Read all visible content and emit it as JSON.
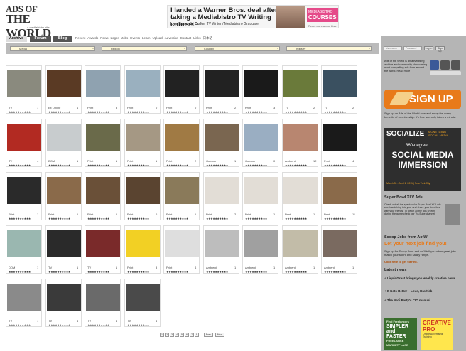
{
  "logo": {
    "line1": "ADS OF",
    "line2": "THE WORLD",
    "sub": "A mediabistro site"
  },
  "ad_banner": {
    "headline": "I landed a Warner Bros. deal after taking a Mediabistro TV Writing course.",
    "name": "Lisa Takeuchi Cullen",
    "name_sub": "TV Writer / Mediabistro Graduate",
    "brand": "MEDIABISTRO",
    "brand_big": "COURSES",
    "more": "Read more about Lisa"
  },
  "nav": {
    "tabs": [
      {
        "label": "Archive",
        "active": true
      },
      {
        "label": "Forum",
        "active": false
      },
      {
        "label": "Blog",
        "active": false
      }
    ],
    "links": [
      "Recent",
      "Awards",
      "News",
      "Logos",
      "Jobs",
      "Events",
      "Learn",
      "Upload",
      "Advertise",
      "Contact",
      "Links",
      "日本語"
    ]
  },
  "filters": [
    "Media",
    "Region",
    "Country",
    "Industry"
  ],
  "search": {
    "button": "Search"
  },
  "cards": [
    {
      "media": "TV",
      "count": "1",
      "thumb": "#8a8a7e"
    },
    {
      "media": "Ex Online",
      "count": "1",
      "thumb": "#5a3a24"
    },
    {
      "media": "Print",
      "count": "3",
      "thumb": "#8fa2b0"
    },
    {
      "media": "Print",
      "count": "0",
      "thumb": "#9ab0bf"
    },
    {
      "media": "Print",
      "count": "0",
      "thumb": "#222"
    },
    {
      "media": "Print",
      "count": "2",
      "thumb": "#222"
    },
    {
      "media": "Print",
      "count": "3",
      "thumb": "#1a1a1a"
    },
    {
      "media": "TV",
      "count": "2",
      "thumb": "#6a7a3a"
    },
    {
      "media": "TV",
      "count": "2",
      "thumb": "#3a5060"
    },
    {
      "media": "TV",
      "count": "4",
      "thumb": "#b22a22"
    },
    {
      "media": "DOM",
      "count": "1",
      "thumb": "#c8ccce"
    },
    {
      "media": "Print",
      "count": "1",
      "thumb": "#6a6a4a"
    },
    {
      "media": "Print",
      "count": "1",
      "thumb": "#a59884"
    },
    {
      "media": "Print",
      "count": "2",
      "thumb": "#a07a44"
    },
    {
      "media": "Outdoor",
      "count": "1",
      "thumb": "#7a6650"
    },
    {
      "media": "Outdoor",
      "count": "0",
      "thumb": "#9aaec2"
    },
    {
      "media": "Ambient",
      "count": "12",
      "thumb": "#b88670"
    },
    {
      "media": "Print",
      "count": "4",
      "thumb": "#1a1a1a"
    },
    {
      "media": "Print",
      "count": "1",
      "thumb": "#2a2a2a"
    },
    {
      "media": "Print",
      "count": "1",
      "thumb": "#8a6a4a"
    },
    {
      "media": "Print",
      "count": "1",
      "thumb": "#6a5038"
    },
    {
      "media": "Print",
      "count": "0",
      "thumb": "#5a4430"
    },
    {
      "media": "Print",
      "count": "1",
      "thumb": "#8a7a5a"
    },
    {
      "media": "Print",
      "count": "2",
      "thumb": "#e2ddd6"
    },
    {
      "media": "Print",
      "count": "1",
      "thumb": "#e2ddd6"
    },
    {
      "media": "Print",
      "count": "1",
      "thumb": "#e2ddd6"
    },
    {
      "media": "Print",
      "count": "11",
      "thumb": "#8a6a4a"
    },
    {
      "media": "DOM",
      "count": "1",
      "thumb": "#9ab7b0"
    },
    {
      "media": "TV",
      "count": "1",
      "thumb": "#2a2a2a"
    },
    {
      "media": "TV",
      "count": "1",
      "thumb": "#7a2a2a"
    },
    {
      "media": "Print",
      "count": "3",
      "thumb": "#f2d024"
    },
    {
      "media": "Print",
      "count": "4",
      "thumb": "#dedede"
    },
    {
      "media": "Ambient",
      "count": "1",
      "thumb": "#bdbdbd"
    },
    {
      "media": "Ambient",
      "count": "1",
      "thumb": "#a0a0a0"
    },
    {
      "media": "Ambient",
      "count": "1",
      "thumb": "#c2bca8"
    },
    {
      "media": "Ambient",
      "count": "1",
      "thumb": "#7a6a60"
    },
    {
      "media": "TV",
      "count": "1",
      "thumb": "#8a8a8a"
    },
    {
      "media": "TV",
      "count": "1",
      "thumb": "#3a3a3a"
    },
    {
      "media": "TV",
      "count": "1",
      "thumb": "#6a6a6a"
    },
    {
      "media": "TV",
      "count": "1",
      "thumb": "#4a4a4a"
    }
  ],
  "stars": "★★★★★★★★★★",
  "pager": {
    "pages": [
      "1",
      "2",
      "3",
      "4",
      "5",
      "6",
      "7",
      "8"
    ],
    "prev": "Prev",
    "next": "Next"
  },
  "sidebar": {
    "login": {
      "user_placeholder": "Username",
      "pass_placeholder": "Password",
      "button": "Log In",
      "signup_link": "Sign up"
    },
    "intro": "Ads of the World is an advertising archive and community showcasing most compelling ads from around the world. Read more",
    "social_colors": [
      "#3b5998",
      "#4f4f4f",
      "#4f4f4f",
      "#4f4f4f"
    ],
    "signup": "SIGN UP",
    "signup_text": "Sign up on Ads of the World now and enjoy the many benefits of membership. It's free and only takes a minute.",
    "social_ad": {
      "title": "SOCIALIZE",
      "tag": "MONETIZING SOCIAL MEDIA",
      "sub": "360-degree",
      "big": "SOCIAL MEDIA IMMERSION",
      "date": "March 31 - April 1, 2011 | New York City"
    },
    "superbowl_heading": "Super Bowl XLV Ads",
    "superbowl_text": "Check out all the spectacular Super Bowl XLV ads worth watching this year and share your favorites with your friends. To watch all the ads shown during the game check our YouTube channel.",
    "jobs_heading": "Scoop Jobs from AotW",
    "jobs_big": "Let your next job find you!",
    "jobs_text": "Sign up for Scoop Jobs and we'll tell you when great jobs match your talent and salary range.",
    "jobs_link": "Click here to get started.",
    "news_heading": "Latest news",
    "news_items": [
      "LiquidGreat brings you weekly creative news",
      "It Gets Better – Love, Draftfcb",
      "The Nazi Party's CIO manual"
    ],
    "freelance": {
      "top": "Find Freelancers",
      "big": "SIMPLER and FASTER",
      "bottom": "FREELANCE MARKETPLACE"
    },
    "creative": {
      "big": "CREATIVE PRO",
      "small": "Online Advertising Training"
    }
  }
}
